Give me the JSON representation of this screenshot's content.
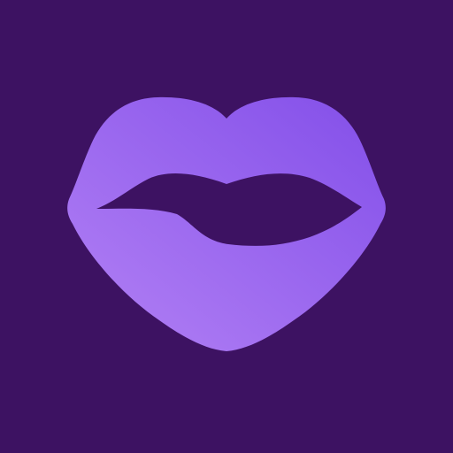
{
  "icon": {
    "name": "lips-icon",
    "colors": {
      "background": "#3d1262",
      "lips_light": "#b07ef4",
      "lips_dark": "#8753ea",
      "mouth_opening": "#3d1262"
    }
  }
}
